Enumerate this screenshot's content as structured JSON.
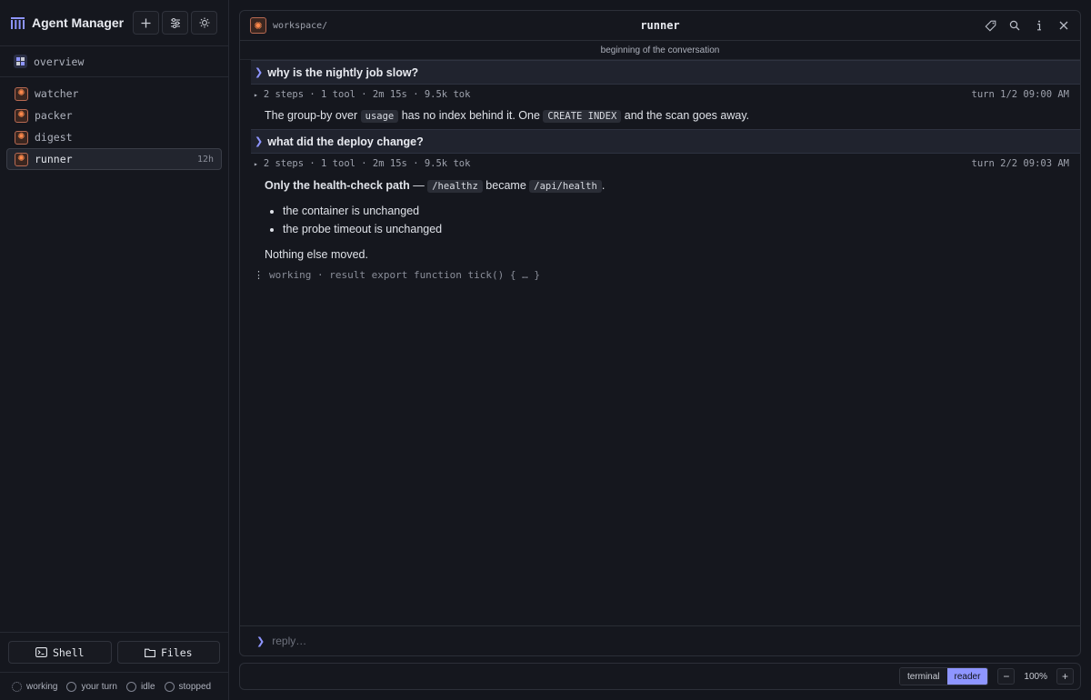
{
  "app": {
    "title": "Agent Manager"
  },
  "header_buttons": [
    {
      "icon": "plus-icon"
    },
    {
      "icon": "sliders-icon"
    },
    {
      "icon": "sun-icon"
    }
  ],
  "sidebar": {
    "overview_label": "overview",
    "agents": [
      {
        "name": "watcher",
        "time": ""
      },
      {
        "name": "packer",
        "time": ""
      },
      {
        "name": "digest",
        "time": ""
      },
      {
        "name": "runner",
        "time": "12h",
        "active": true
      }
    ],
    "actions": {
      "shell": "Shell",
      "files": "Files"
    },
    "legend": [
      "working",
      "your turn",
      "idle",
      "stopped"
    ]
  },
  "main": {
    "breadcrumb": "workspace/",
    "title": "runner",
    "tools": [
      "tag-icon",
      "search-icon",
      "info-icon",
      "close-icon"
    ],
    "conversation_start": "beginning of the conversation",
    "turns": [
      {
        "user": "why is the nightly job slow?",
        "meta": "2 steps · 1 tool · 2m 15s · 9.5k tok",
        "turn_label": "turn 1/2 09:00 AM",
        "response": {
          "t1": "The group-by over",
          "c1": "usage",
          "t2": "has no index behind it. One",
          "c2": "CREATE INDEX",
          "t3": "and the scan goes away."
        }
      },
      {
        "user": "what did the deploy change?",
        "meta": "2 steps · 1 tool · 2m 15s · 9.5k tok",
        "turn_label": "turn 2/2 09:03 AM",
        "response": {
          "bold": "Only the health-check path",
          "dash": "—",
          "c1": "/healthz",
          "t1": "became",
          "c2": "/api/health",
          "t2": ".",
          "bullets": [
            "the container is unchanged",
            "the probe timeout is unchanged"
          ],
          "closing": "Nothing else moved."
        }
      }
    ],
    "working": "working · result export function tick() { … }",
    "reply_placeholder": "reply…"
  },
  "footer": {
    "modes": [
      "terminal",
      "reader"
    ],
    "active_mode": "reader",
    "zoom_minus": "−",
    "zoom": "100%",
    "zoom_plus": "+"
  },
  "colors": {
    "accent": "#8e95ff",
    "agent_icon": "#ff8a4c",
    "background": "#14161d"
  }
}
